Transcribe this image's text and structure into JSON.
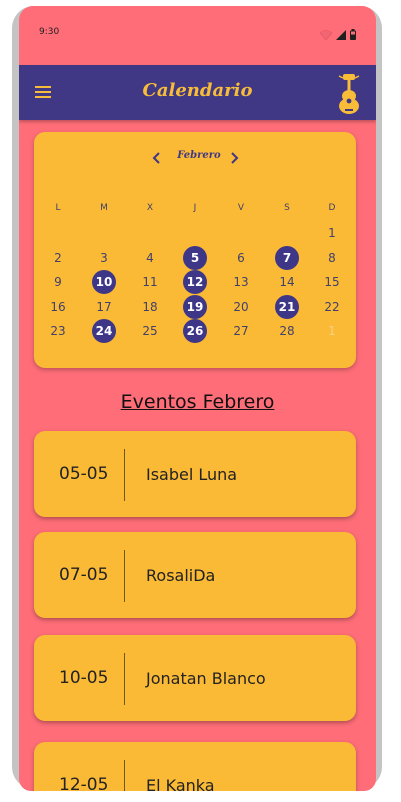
{
  "status_bar": {
    "time": "9:30"
  },
  "app_bar": {
    "title": "Calendario",
    "menu_icon": "hamburger-menu-icon",
    "logo_icon": "guitar-logo-icon"
  },
  "calendar": {
    "month": "Febrero",
    "weekdays": [
      "L",
      "M",
      "X",
      "J",
      "V",
      "S",
      "D"
    ],
    "weeks": [
      [
        "",
        "",
        "",
        "",
        "",
        "",
        "1"
      ],
      [
        "2",
        "3",
        "4",
        "5",
        "6",
        "7",
        "8"
      ],
      [
        "9",
        "10",
        "11",
        "12",
        "13",
        "14",
        "15"
      ],
      [
        "16",
        "17",
        "18",
        "19",
        "20",
        "21",
        "22"
      ],
      [
        "23",
        "24",
        "25",
        "26",
        "27",
        "28",
        "1"
      ]
    ],
    "highlighted_days": [
      "5",
      "7",
      "10",
      "12",
      "19",
      "21",
      "24",
      "26"
    ],
    "colors": {
      "card": "#fbba36",
      "highlight": "#3e3788"
    }
  },
  "events_section": {
    "title": "Eventos Febrero",
    "events": [
      {
        "date": "05-05",
        "artist": "Isabel Luna"
      },
      {
        "date": "07-05",
        "artist": "RosaliDa"
      },
      {
        "date": "10-05",
        "artist": "Jonatan Blanco"
      },
      {
        "date": "12-05",
        "artist": "El Kanka"
      }
    ]
  },
  "theme": {
    "background": "#fe6d78",
    "app_bar": "#403785",
    "accent": "#f7bd39"
  }
}
